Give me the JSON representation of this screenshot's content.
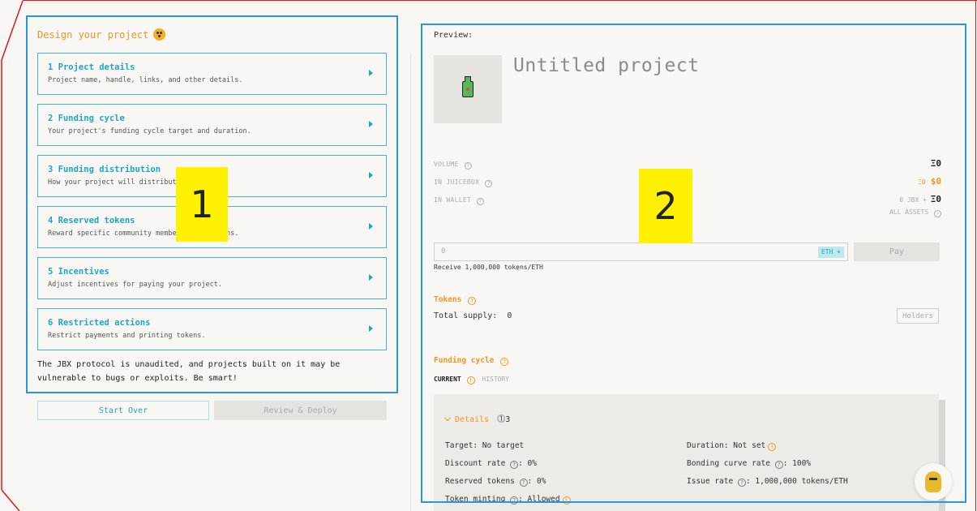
{
  "colors": {
    "accent_orange": "#ec9628",
    "accent_teal": "#1fa6c0",
    "annotation_box": "#2a95e6",
    "annotation_frame": "#e01818",
    "marker_yellow": "#fff200"
  },
  "annotations": {
    "marker_1": "1",
    "marker_2": "2"
  },
  "design": {
    "title": "Design your project",
    "title_icon": "palette-icon",
    "steps": [
      {
        "title": "1 Project details",
        "description": "Project name, handle, links, and other details."
      },
      {
        "title": "2 Funding cycle",
        "description": "Your project's funding cycle target and duration."
      },
      {
        "title": "3 Funding distribution",
        "description": "How your project will distribute funds."
      },
      {
        "title": "4 Reserved tokens",
        "description": "Reward specific community members with tokens."
      },
      {
        "title": "5 Incentives",
        "description": "Adjust incentives for paying your project."
      },
      {
        "title": "6 Restricted actions",
        "description": "Restrict payments and printing tokens."
      }
    ],
    "warning": "The JBX protocol is unaudited, and projects built on it may be vulnerable to bugs or exploits. Be smart!",
    "start_over_label": "Start Over",
    "review_deploy_label": "Review & Deploy"
  },
  "preview": {
    "label": "Preview:",
    "project_name": "Untitled project",
    "logo_icon": "juicebox-icon",
    "volume_label": "VOLUME",
    "volume_value": "Ξ0",
    "in_juicebox_label": "IN JUICEBOX",
    "in_juicebox_eth": "Ξ0",
    "in_juicebox_usd": "$0",
    "in_wallet_label": "IN WALLET",
    "in_wallet_jbx": "0 JBX + ",
    "in_wallet_eth": "Ξ0",
    "all_assets_label": "ALL ASSETS",
    "pay_placeholder": "0",
    "currency": "ETH",
    "pay_label": "Pay",
    "receive_text": "Receive 1,000,000 tokens/ETH",
    "tokens_title": "Tokens",
    "total_supply_label": "Total supply:",
    "total_supply_value": "0",
    "holders_label": "Holders",
    "funding_cycle_title": "Funding cycle",
    "tab_current": "CURRENT",
    "tab_history": "HISTORY",
    "details_label": "Details",
    "details_count": "3",
    "details": {
      "target_label": "Target:",
      "target_value": "No target",
      "duration_label": "Duration:",
      "duration_value": "Not set",
      "discount_label": "Discount rate",
      "discount_value": ": 0%",
      "bonding_label": "Bonding curve rate",
      "bonding_value": ": 100%",
      "reserved_label": "Reserved tokens",
      "reserved_value": ": 0%",
      "issue_label": "Issue rate",
      "issue_value": ": 1,000,000 tokens/ETH",
      "minting_label": "Token minting",
      "minting_value": ": Allowed"
    }
  }
}
